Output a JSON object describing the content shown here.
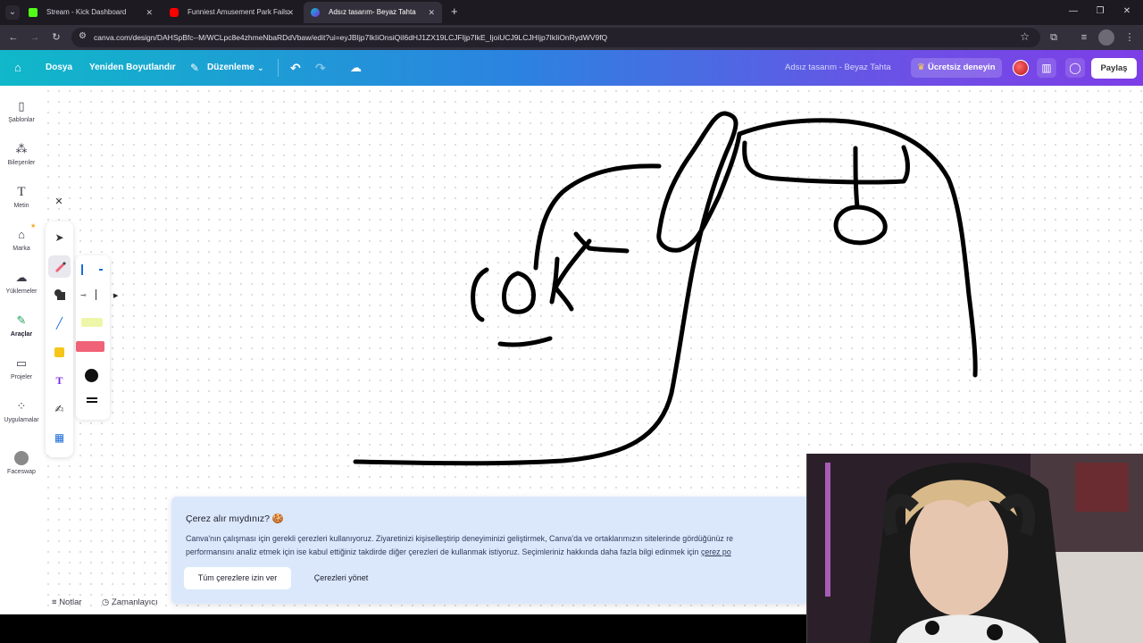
{
  "browser": {
    "tabs": [
      {
        "title": "Stream - Kick Dashboard",
        "favicon_color": "#53fc18"
      },
      {
        "title": "Funniest Amusement Park Fails",
        "favicon_color": "#ff0000"
      },
      {
        "title": "Adsız tasarım- Beyaz Tahta",
        "favicon_color": "#7d2ae8"
      }
    ],
    "address": "canva.com/design/DAHSpBfc--M/WCLpc8e4zhmeNbaRDdVbaw/edit?ui=eyJBIjp7IkIiOnsiQiI6dHJ1ZX19LCJFIjp7IkE_IjoiUCJ9LCJHIjp7IkIiOnRydWV9fQ"
  },
  "canva_bar": {
    "file_label": "Dosya",
    "resize_label": "Yeniden Boyutlandır",
    "edit_label": "Düzenleme",
    "doc_title": "Adsız tasarım - Beyaz Tahta",
    "trial_label": "Ücretsiz deneyin",
    "share_label": "Paylaş"
  },
  "sidebar": {
    "items": [
      {
        "label": "Şablonlar",
        "icon": "template-icon"
      },
      {
        "label": "Bileşenler",
        "icon": "elements-icon"
      },
      {
        "label": "Metin",
        "icon": "text-icon"
      },
      {
        "label": "Marka",
        "icon": "brand-icon"
      },
      {
        "label": "Yüklemeler",
        "icon": "upload-icon"
      },
      {
        "label": "Araçlar",
        "icon": "tools-icon"
      },
      {
        "label": "Projeler",
        "icon": "folder-icon"
      },
      {
        "label": "Uygulamalar",
        "icon": "apps-icon"
      },
      {
        "label": "Faceswap",
        "icon": "faceswap-icon"
      }
    ]
  },
  "cookie": {
    "title": "Çerez alır mıydınız? 🍪",
    "line1": "Canva'nın çalışması için gerekli çerezleri kullanıyoruz. Ziyaretinizi kişiselleştirip deneyiminizi geliştirmek, Canva'da ve ortaklarımızın sitelerinde gördüğünüz re",
    "line2_a": "performansını analiz etmek için ise kabul ettiğiniz takdirde diğer çerezleri de kullanmak istiyoruz. Seçimleriniz hakkında daha fazla bilgi edinmek için ",
    "line2_link": "çerez po",
    "accept_label": "Tüm çerezlere izin ver",
    "manage_label": "Çerezleri yönet"
  },
  "bottom": {
    "notes_label": "Notlar",
    "timer_label": "Zamanlayıcı"
  },
  "colors": {
    "accent": "#7d2ae8",
    "ink": "#000000",
    "highlighter_yellow": "#e9f56b",
    "marker_pink": "#f06277",
    "sticky_yellow": "#f5c518",
    "text_tool_purple": "#7d2ae8"
  }
}
